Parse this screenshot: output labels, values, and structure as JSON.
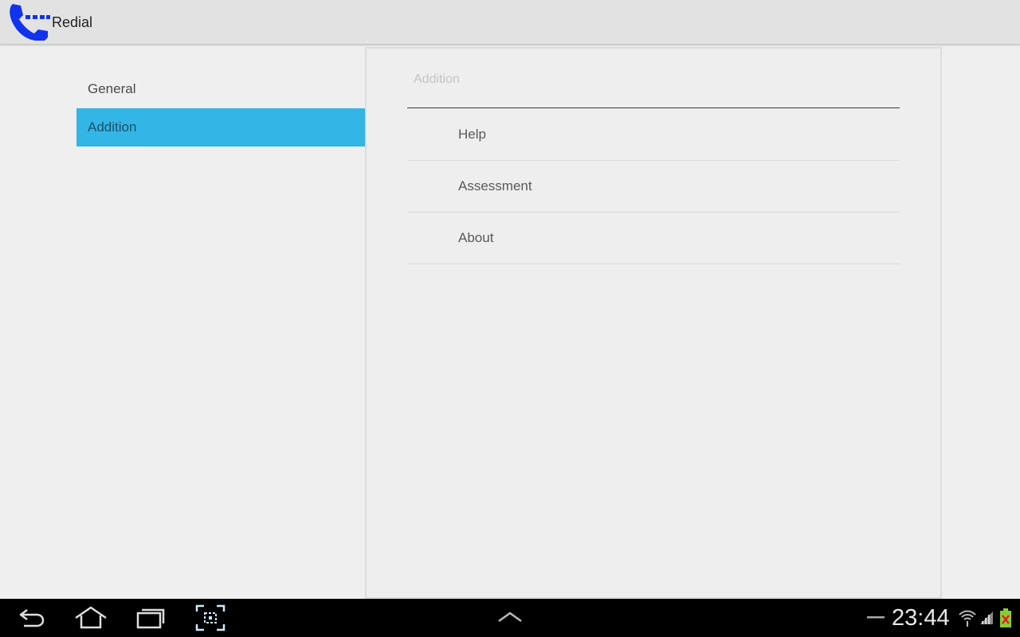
{
  "action_bar": {
    "title": "Redial",
    "app_icon": "phone-redial-icon",
    "accent_color": "#1133ee"
  },
  "headers": [
    {
      "label": "General",
      "selected": false
    },
    {
      "label": "Addition",
      "selected": true
    }
  ],
  "panel": {
    "category_title": "Addition",
    "items": [
      {
        "label": "Help"
      },
      {
        "label": "Assessment"
      },
      {
        "label": "About"
      }
    ]
  },
  "system_bar": {
    "buttons": [
      "back-icon",
      "home-icon",
      "recent-apps-icon",
      "screenshot-icon",
      "chevron-up-icon"
    ],
    "clock": "23:44",
    "status_icons": [
      "minus-icon",
      "wifi-icon",
      "signal-icon",
      "battery-icon"
    ]
  },
  "colors": {
    "selected_header": "#33b5e5",
    "background": "#efeff0",
    "action_bar": "#e2e2e3"
  }
}
